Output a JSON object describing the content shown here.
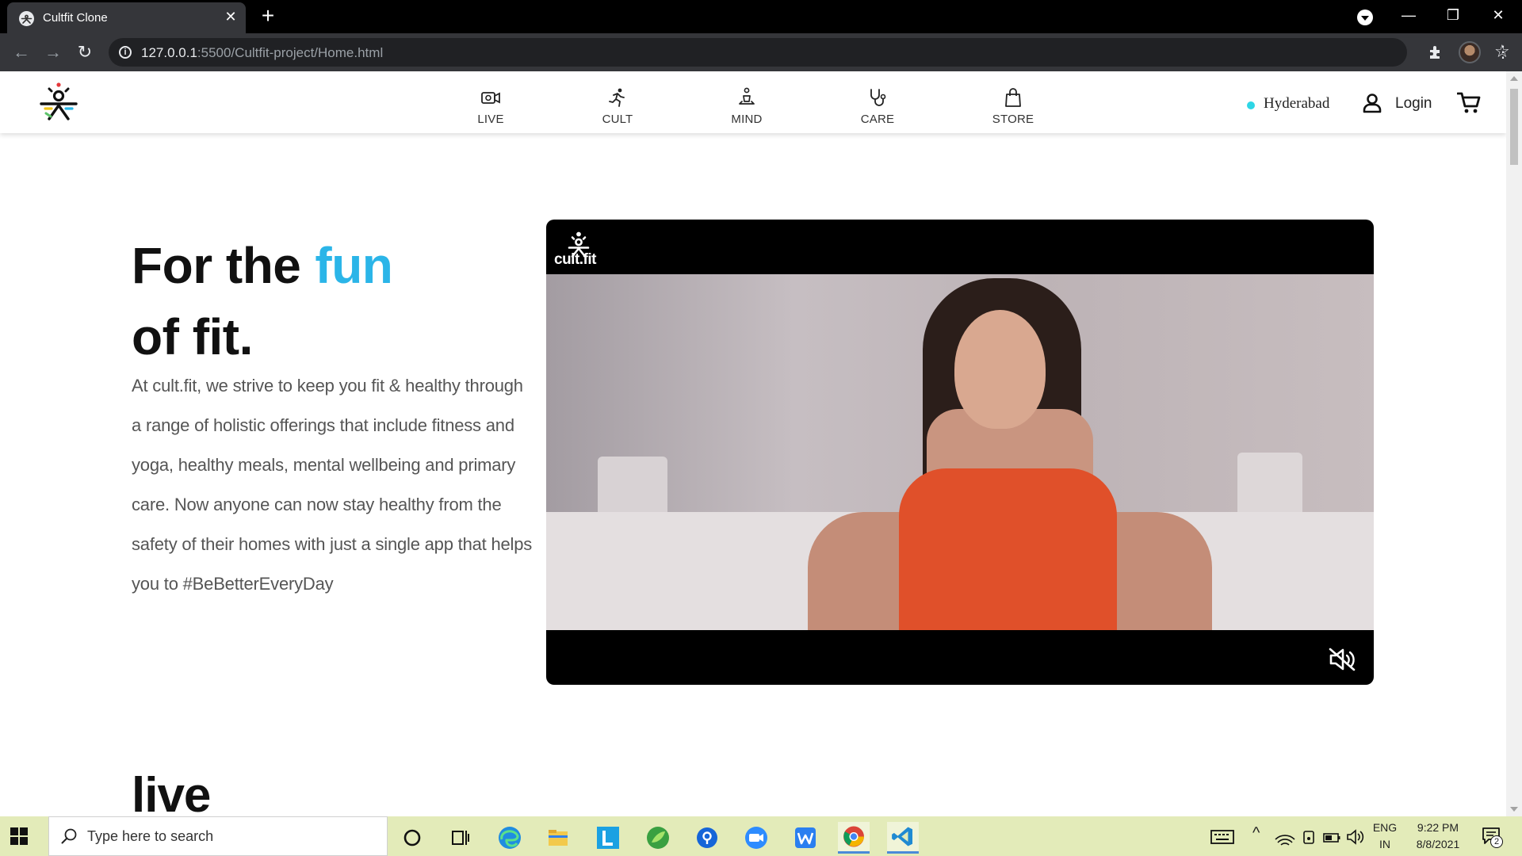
{
  "browser": {
    "tab_title": "Cultfit Clone",
    "url_host": "127.0.0.1",
    "url_rest": ":5500/Cultfit-project/Home.html"
  },
  "header": {
    "nav": [
      {
        "label": "LIVE",
        "icon": "video-camera-icon"
      },
      {
        "label": "CULT",
        "icon": "running-person-icon"
      },
      {
        "label": "MIND",
        "icon": "meditation-icon"
      },
      {
        "label": "CARE",
        "icon": "stethoscope-icon"
      },
      {
        "label": "STORE",
        "icon": "shopping-bag-icon"
      }
    ],
    "city": "Hyderabad",
    "login": "Login"
  },
  "hero": {
    "title_line1": "For the",
    "title_accent": "fun",
    "title_line2": "of fit.",
    "description": "At cult.fit, we strive to keep you fit & healthy through a range of holistic offerings that include fitness and yoga, healthy meals, mental wellbeing and primary care. Now anyone can now stay healthy from the safety of their homes with just a single app that helps you to #BeBetterEveryDay",
    "accent_color": "#2bb5e8"
  },
  "video": {
    "logo_text": "cult.fit",
    "muted": true
  },
  "sections": {
    "live_title": "live"
  },
  "taskbar": {
    "search_placeholder": "Type here to search",
    "lang_top": "ENG",
    "lang_bottom": "IN",
    "time": "9:22 PM",
    "date": "8/8/2021",
    "notification_count": "2"
  }
}
